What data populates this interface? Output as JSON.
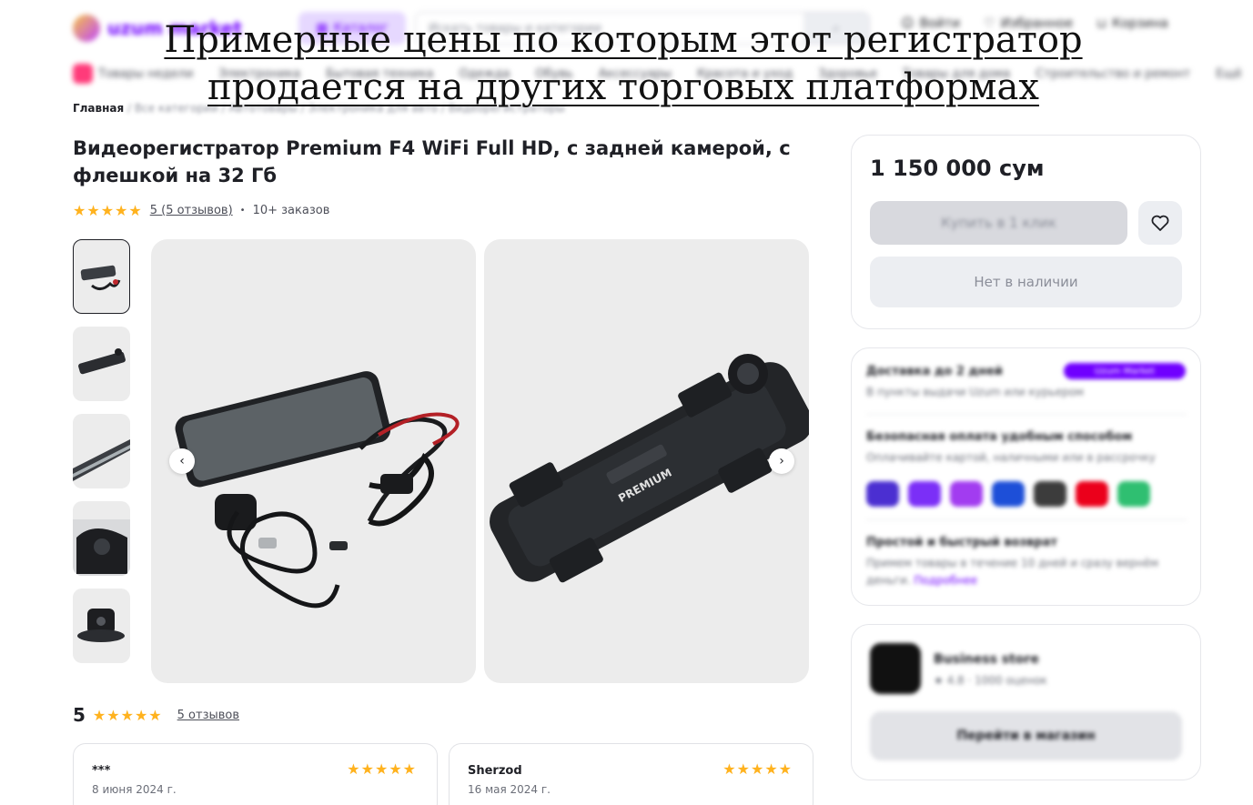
{
  "overlay": {
    "line1": "Примерные цены по которым этот регистратор",
    "line2": "продается на других торговых платформах"
  },
  "header": {
    "logo_text": "uzum market",
    "catalog_label": "Каталог",
    "search_placeholder": "Искать товары и категории",
    "actions": [
      "Войти",
      "Избранное",
      "Корзина"
    ]
  },
  "categories": [
    "Товары недели",
    "Электроника",
    "Бытовая техника",
    "Одежда",
    "Обувь",
    "Аксессуары",
    "Красота и уход",
    "Здоровье",
    "Товары для дома",
    "Строительство и ремонт",
    "Ещё"
  ],
  "breadcrumbs": {
    "first": "Главная",
    "rest": "/ Все категории / Автотовары / Электроника для авто / Видеорегистраторы"
  },
  "product": {
    "title": "Видеорегистратор Premium F4 WiFi Full HD, с задней камерой, с флешкой на 32 Гб",
    "stars": "★★★★★",
    "reviews_link": "5 (5 отзывов)",
    "orders": "10+ заказов"
  },
  "price_panel": {
    "price": "1 150 000 сум",
    "buy_one_click": "Купить в 1 клик",
    "out_of_stock": "Нет в наличии"
  },
  "info_panel": {
    "delivery_title": "Доставка до 2 дней",
    "delivery_badge": "Uzum Market",
    "delivery_sub": "В пункты выдачи Uzum или курьером",
    "payment_title": "Безопасная оплата удобным способом",
    "payment_sub": "Оплачивайте картой, наличными или в рассрочку",
    "return_title": "Простой и быстрый возврат",
    "return_sub": "Примем товары в течение 10 дней и сразу вернём деньги.",
    "return_link": "Подробнее",
    "pay_colors": [
      "#4b2fd1",
      "#7b2ff7",
      "#a23cf0",
      "#1d4fd8",
      "#3c3c3c",
      "#eb001b",
      "#2fbf71"
    ]
  },
  "store_panel": {
    "name": "Business store",
    "rating": "★ 4.8 · 1000 оценок",
    "button": "Перейти в магазин"
  },
  "reviews": {
    "score": "5",
    "stars": "★★★★★",
    "link": "5 отзывов",
    "items": [
      {
        "author": "***",
        "date": "8 июня 2024 г.",
        "stars": "★★★★★"
      },
      {
        "author": "Sherzod",
        "date": "16 мая 2024 г.",
        "stars": "★★★★★"
      }
    ]
  }
}
